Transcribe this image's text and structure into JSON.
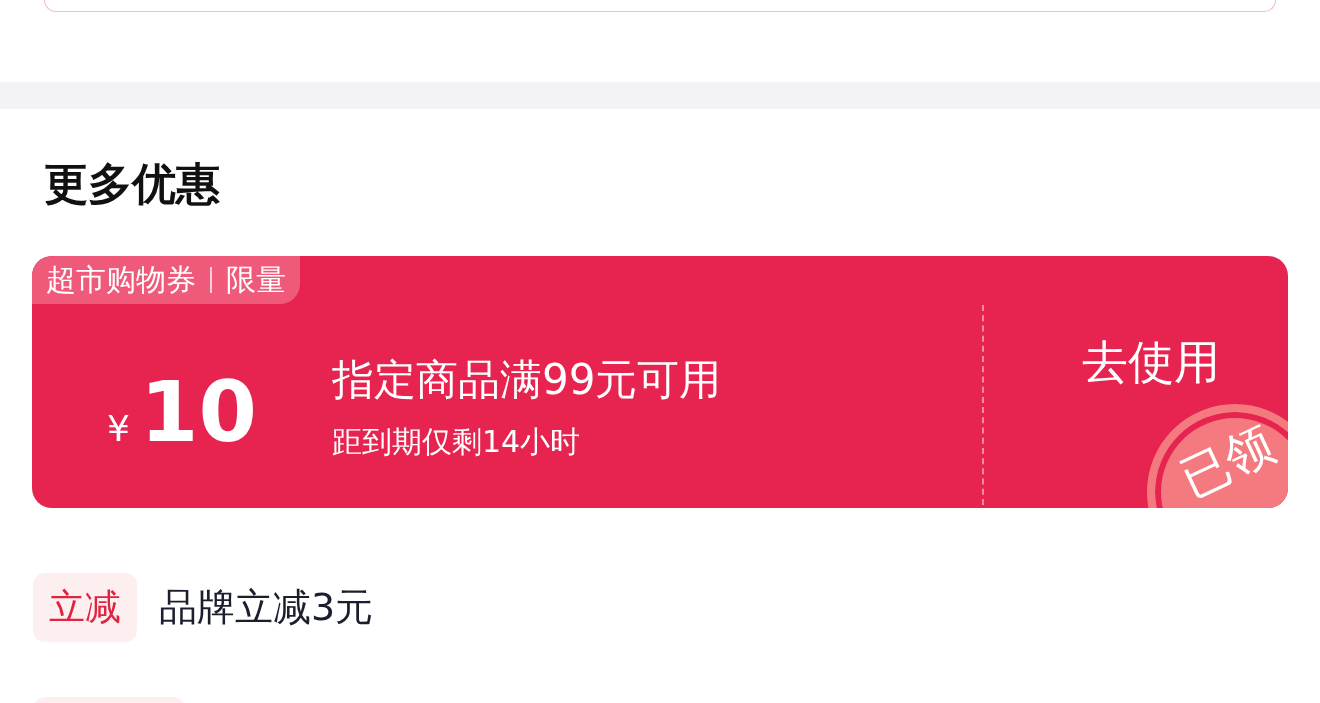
{
  "section_title": "更多优惠",
  "coupon": {
    "tag": "超市购物券",
    "tag_suffix": "限量",
    "currency": "¥",
    "amount": "10",
    "condition": "指定商品满99元可用",
    "expiry": "距到期仅剩14小时",
    "action": "去使用",
    "claimed": true,
    "stamp": "已领"
  },
  "offers": [
    {
      "badge": "立减",
      "text": "品牌立减3元"
    }
  ]
}
